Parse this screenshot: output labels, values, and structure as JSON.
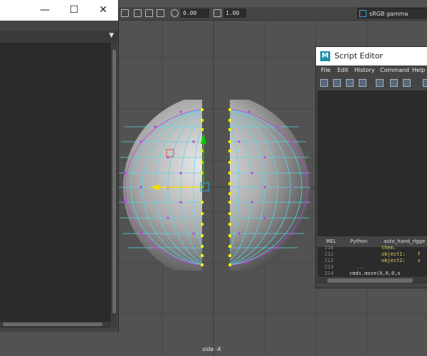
{
  "viewport": {
    "camera_label": "side -X",
    "toolbar": {
      "field1_value": "0.00",
      "field2_value": "1.00",
      "colorspace_value": "sRGB gamma"
    }
  },
  "left_window": {
    "controls": {
      "minimize": "—",
      "maximize": "☐",
      "close": "✕"
    }
  },
  "script_editor": {
    "title": "Script Editor",
    "logo_letter": "M",
    "menu": [
      "File",
      "Edit",
      "History",
      "Command",
      "Help"
    ],
    "tabs": [
      "MEL",
      "Python",
      "auto_hand_rigge"
    ],
    "code_lines": [
      {
        "ln": "210",
        "text": "them."
      },
      {
        "ln": "211",
        "text": "object1:    f"
      },
      {
        "ln": "212",
        "text": "object2:    s"
      },
      {
        "ln": "213",
        "text": "..."
      },
      {
        "ln": "214",
        "text": "cmds.move(0,0,0,o"
      }
    ]
  },
  "colors": {
    "wire_cyan": "#5ad6e8",
    "wire_magenta": "#c040e0",
    "vertex_yellow": "#e8f000",
    "manip_green": "#00d000",
    "manip_yellow": "#f0e000",
    "manip_blue": "#3aa0c8"
  }
}
